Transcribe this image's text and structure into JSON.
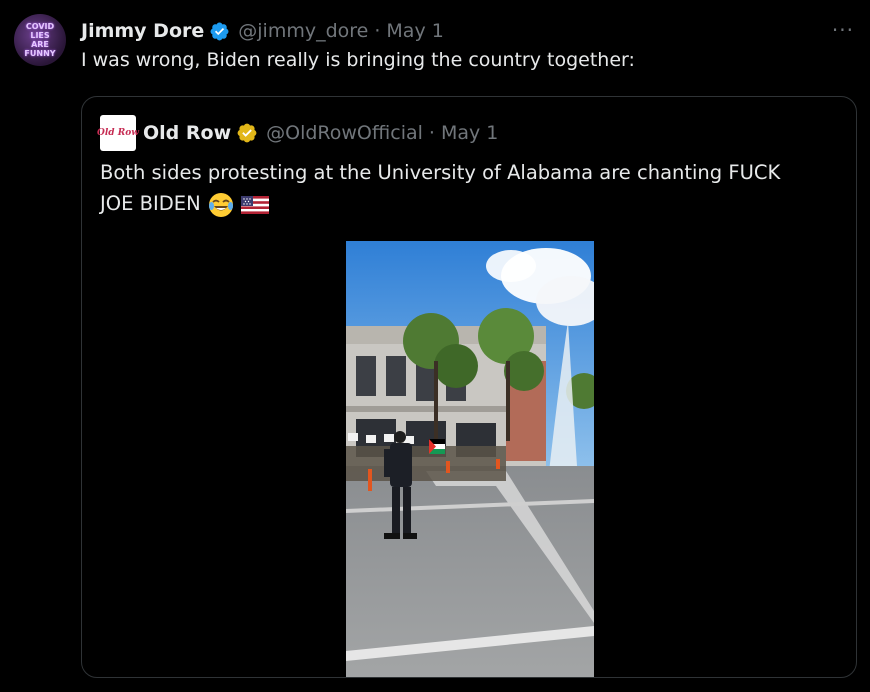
{
  "tweet": {
    "author_name": "Jimmy Dore",
    "handle": "@jimmy_dore",
    "separator": "·",
    "date": "May 1",
    "text": "I was wrong, Biden really is bringing the country together:",
    "more_label": "···",
    "avatar_text": [
      "COVID",
      "LIES",
      "ARE",
      "FUNNY"
    ]
  },
  "quote": {
    "author_name": "Old Row",
    "handle": "@OldRowOfficial",
    "separator": "·",
    "date": "May 1",
    "avatar_text": "Old Row",
    "text_line1": "Both sides protesting at the University of Alabama are chanting FUCK",
    "text_line2": "JOE BIDEN"
  },
  "colors": {
    "background": "#000000",
    "text_primary": "#e7e9ea",
    "text_secondary": "#71767b",
    "verified_blue": "#1d9bf0",
    "verified_gold": "#e2b719",
    "border": "#2f3336"
  },
  "icons": {
    "verified": "verified-badge-icon",
    "gold_verified": "gold-verified-badge-icon",
    "more": "more-options-icon",
    "laughing": "face-with-tears-of-joy-icon",
    "flag": "us-flag-icon"
  }
}
